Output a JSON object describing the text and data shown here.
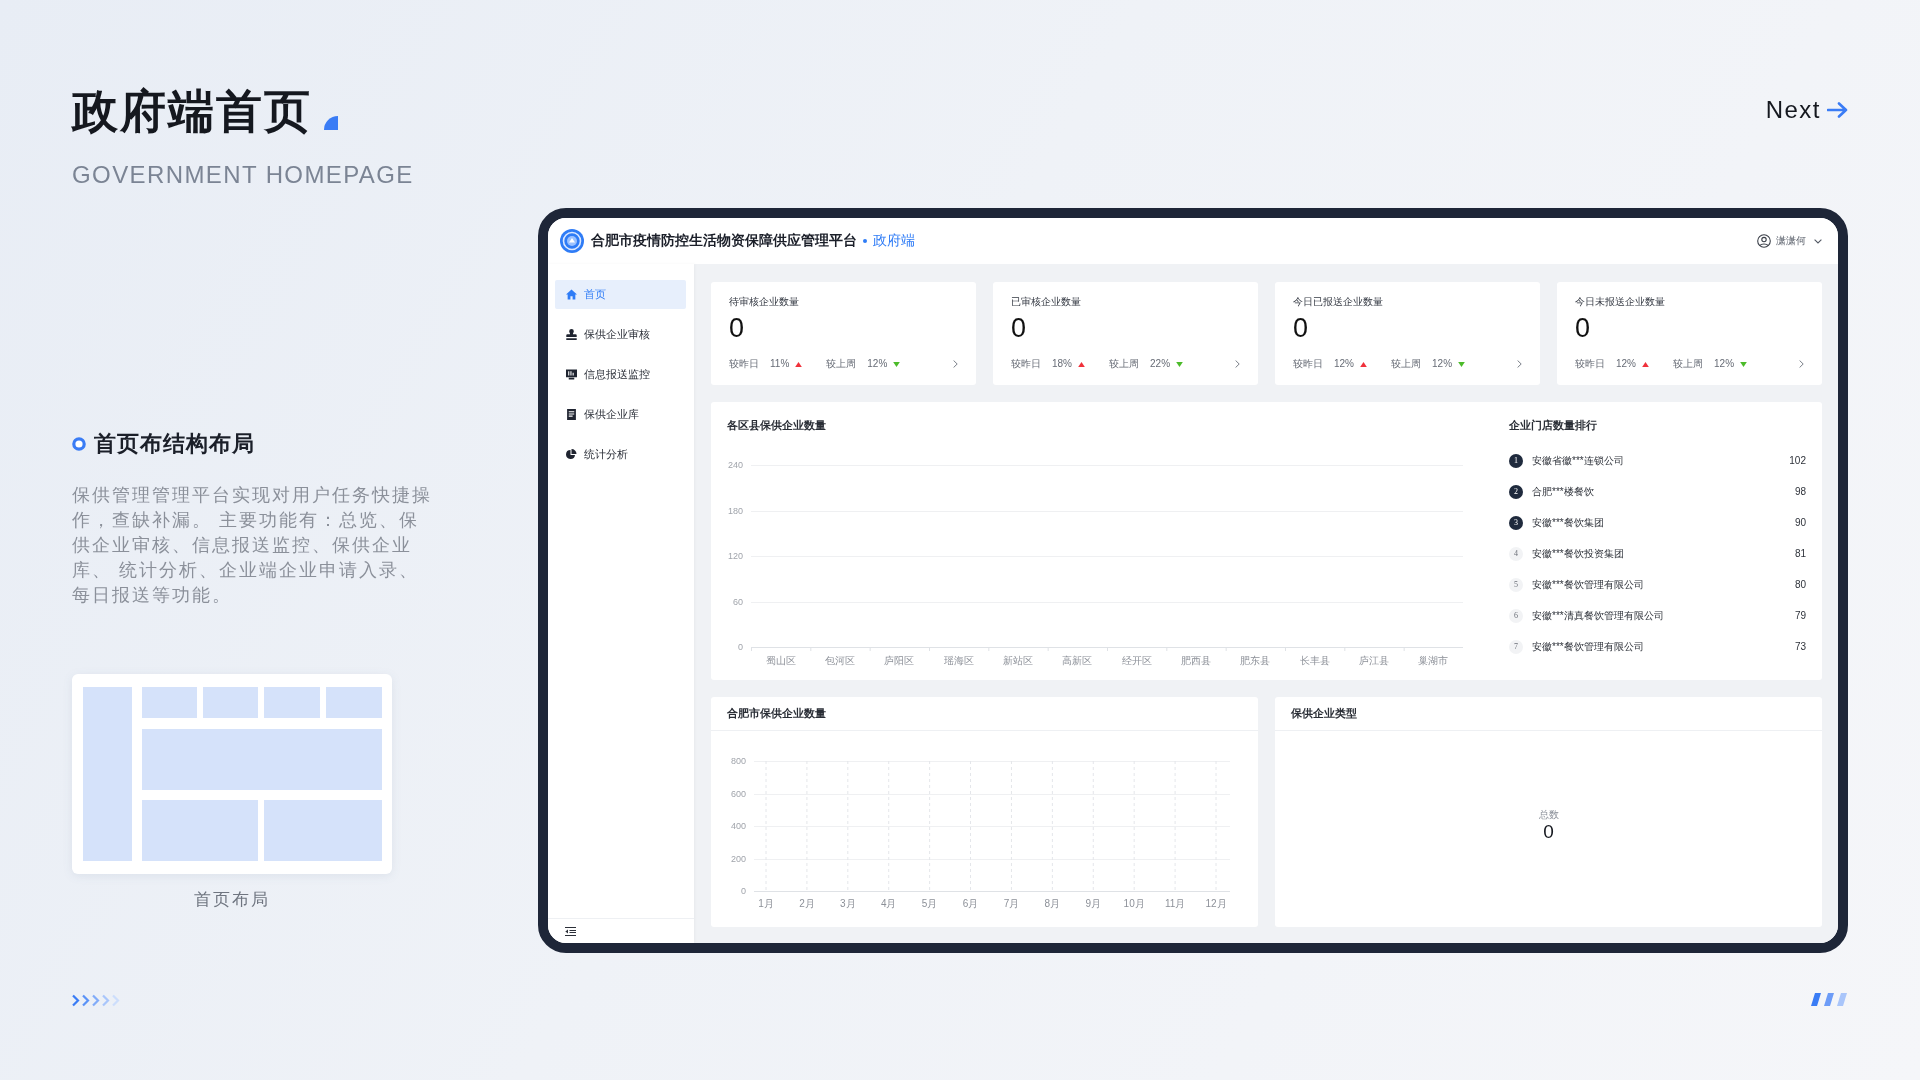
{
  "slide": {
    "title": "政府端首页",
    "subtitle": "GOVERNMENT HOMEPAGE",
    "next_label": "Next"
  },
  "section": {
    "heading": "首页布结构布局",
    "description": "保供管理管理平台实现对用户任务快捷操作，查缺补漏。 主要功能有：总览、保供企业审核、信息报送监控、保供企业库、 统计分析、企业端企业申请入录、每日报送等功能。",
    "layout_caption": "首页布局"
  },
  "app": {
    "header": {
      "title": "合肥市疫情防控生活物资保障供应管理平台",
      "role": "政府端",
      "user": "潇潇何"
    },
    "sidebar": {
      "items": [
        {
          "label": "首页",
          "selected": true
        },
        {
          "label": "保供企业审核",
          "selected": false
        },
        {
          "label": "信息报送监控",
          "selected": false
        },
        {
          "label": "保供企业库",
          "selected": false
        },
        {
          "label": "统计分析",
          "selected": false
        }
      ]
    },
    "stat_cards": [
      {
        "title": "待审核企业数量",
        "value": "0",
        "comparisons": [
          {
            "label": "较昨日",
            "value": "11%",
            "rising": true
          },
          {
            "label": "较上周",
            "value": "12%",
            "rising": false
          }
        ]
      },
      {
        "title": "已审核企业数量",
        "value": "0",
        "comparisons": [
          {
            "label": "较昨日",
            "value": "18%",
            "rising": true
          },
          {
            "label": "较上周",
            "value": "22%",
            "rising": false
          }
        ]
      },
      {
        "title": "今日已报送企业数量",
        "value": "0",
        "comparisons": [
          {
            "label": "较昨日",
            "value": "12%",
            "rising": true
          },
          {
            "label": "较上周",
            "value": "12%",
            "rising": false
          }
        ]
      },
      {
        "title": "今日未报送企业数量",
        "value": "0",
        "comparisons": [
          {
            "label": "较昨日",
            "value": "12%",
            "rising": true
          },
          {
            "label": "较上周",
            "value": "12%",
            "rising": false
          }
        ]
      }
    ],
    "district_chart": {
      "chart_data": {
        "type": "bar",
        "title": "各区县保供企业数量",
        "categories": [
          "蜀山区",
          "包河区",
          "庐阳区",
          "瑶海区",
          "新站区",
          "高新区",
          "经开区",
          "肥西县",
          "肥东县",
          "长丰县",
          "庐江县",
          "巢湖市"
        ],
        "ylim": [
          0,
          240
        ],
        "yticks": [
          0,
          60,
          120,
          180,
          240
        ],
        "grid": true
      }
    },
    "ranking": {
      "title": "企业门店数量排行",
      "items": [
        {
          "rank": "1",
          "name": "安徽省徽***连锁公司",
          "value": "102",
          "highlighted": true
        },
        {
          "rank": "2",
          "name": "合肥***楼餐饮",
          "value": "98",
          "highlighted": true
        },
        {
          "rank": "3",
          "name": "安徽***餐饮集团",
          "value": "90",
          "highlighted": true
        },
        {
          "rank": "4",
          "name": "安徽***餐饮投资集团",
          "value": "81",
          "highlighted": false
        },
        {
          "rank": "5",
          "name": "安徽***餐饮管理有限公司",
          "value": "80",
          "highlighted": false
        },
        {
          "rank": "6",
          "name": "安徽***清真餐饮管理有限公司",
          "value": "79",
          "highlighted": false
        },
        {
          "rank": "7",
          "name": "安徽***餐饮管理有限公司",
          "value": "73",
          "highlighted": false
        }
      ]
    },
    "monthly_chart": {
      "chart_data": {
        "type": "line",
        "title": "合肥市保供企业数量",
        "categories": [
          "1月",
          "2月",
          "3月",
          "4月",
          "5月",
          "6月",
          "7月",
          "8月",
          "9月",
          "10月",
          "11月",
          "12月"
        ],
        "ylim": [
          0,
          800
        ],
        "yticks": [
          0,
          200,
          400,
          600,
          800
        ],
        "grid": true
      }
    },
    "type_card": {
      "title": "保供企业类型",
      "total_label": "总数",
      "total_value": "0"
    }
  }
}
